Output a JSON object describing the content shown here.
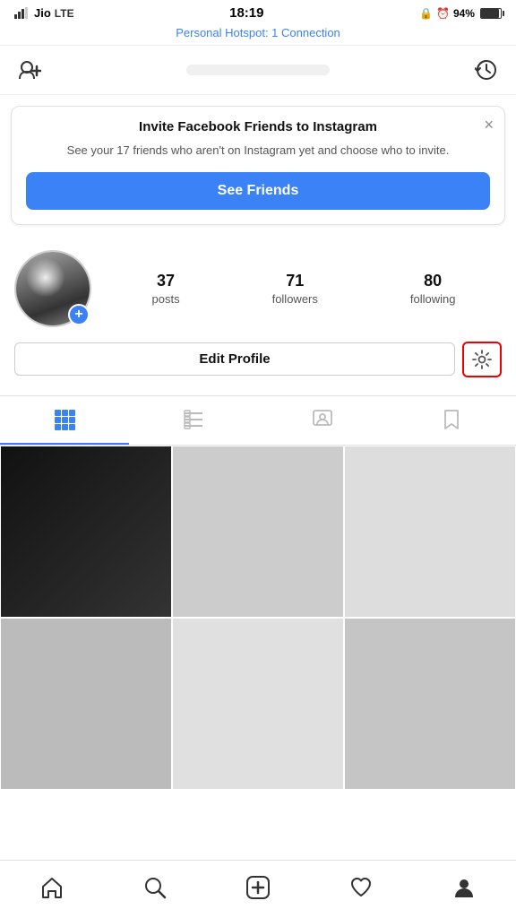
{
  "statusBar": {
    "carrier": "Jio",
    "network": "LTE",
    "time": "18:19",
    "battery": "94%",
    "hotspot": "Personal Hotspot: 1 Connection"
  },
  "topNav": {
    "addFriendLabel": "+",
    "historyLabel": "↺"
  },
  "inviteBanner": {
    "title": "Invite Facebook Friends to Instagram",
    "subtitle": "See your 17 friends who aren't on Instagram yet and choose who to invite.",
    "buttonLabel": "See Friends",
    "closeLabel": "×"
  },
  "profile": {
    "stats": [
      {
        "number": "37",
        "label": "posts"
      },
      {
        "number": "71",
        "label": "followers"
      },
      {
        "number": "80",
        "label": "following"
      }
    ],
    "editProfileLabel": "Edit Profile",
    "settingsLabel": "⚙"
  },
  "tabs": [
    {
      "id": "grid",
      "label": "grid"
    },
    {
      "id": "list",
      "label": "list"
    },
    {
      "id": "tagged",
      "label": "tagged"
    },
    {
      "id": "saved",
      "label": "saved"
    }
  ],
  "bottomNav": [
    {
      "id": "home",
      "label": "home"
    },
    {
      "id": "search",
      "label": "search"
    },
    {
      "id": "add",
      "label": "add"
    },
    {
      "id": "heart",
      "label": "heart"
    },
    {
      "id": "profile",
      "label": "profile"
    }
  ]
}
